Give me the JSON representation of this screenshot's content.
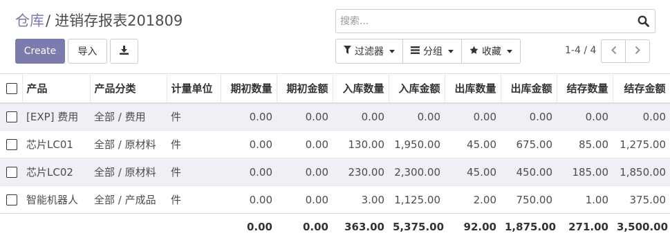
{
  "breadcrumb": {
    "parent": "仓库",
    "separator": "/",
    "current": "进销存报表201809"
  },
  "buttons": {
    "create": "Create",
    "import": "导入"
  },
  "search": {
    "placeholder": "搜索..."
  },
  "filters": {
    "filter": "过滤器",
    "group": "分组",
    "favorites": "收藏"
  },
  "pager": {
    "text": "1-4 / 4"
  },
  "table": {
    "headers": [
      "产品",
      "产品分类",
      "计量单位",
      "期初数量",
      "期初金额",
      "入库数量",
      "入库金额",
      "出库数量",
      "出库金额",
      "结存数量",
      "结存金额"
    ],
    "rows": [
      [
        "[EXP] 费用",
        "全部 / 费用",
        "件",
        "0.00",
        "0.00",
        "0.00",
        "0.00",
        "0.00",
        "0.00",
        "0.00",
        "0.00"
      ],
      [
        "芯片LC01",
        "全部 / 原材料",
        "件",
        "0.00",
        "0.00",
        "130.00",
        "1,950.00",
        "45.00",
        "675.00",
        "85.00",
        "1,275.00"
      ],
      [
        "芯片LC02",
        "全部 / 原材料",
        "件",
        "0.00",
        "0.00",
        "230.00",
        "2,300.00",
        "45.00",
        "450.00",
        "185.00",
        "1,850.00"
      ],
      [
        "智能机器人",
        "全部 / 产成品",
        "件",
        "0.00",
        "0.00",
        "3.00",
        "1,125.00",
        "2.00",
        "750.00",
        "1.00",
        "375.00"
      ]
    ],
    "totals": [
      "0.00",
      "0.00",
      "363.00",
      "5,375.00",
      "92.00",
      "1,875.00",
      "271.00",
      "3,500.00"
    ]
  },
  "colors": {
    "primary": "#7c7bad",
    "row_alt": "#efeff6"
  }
}
